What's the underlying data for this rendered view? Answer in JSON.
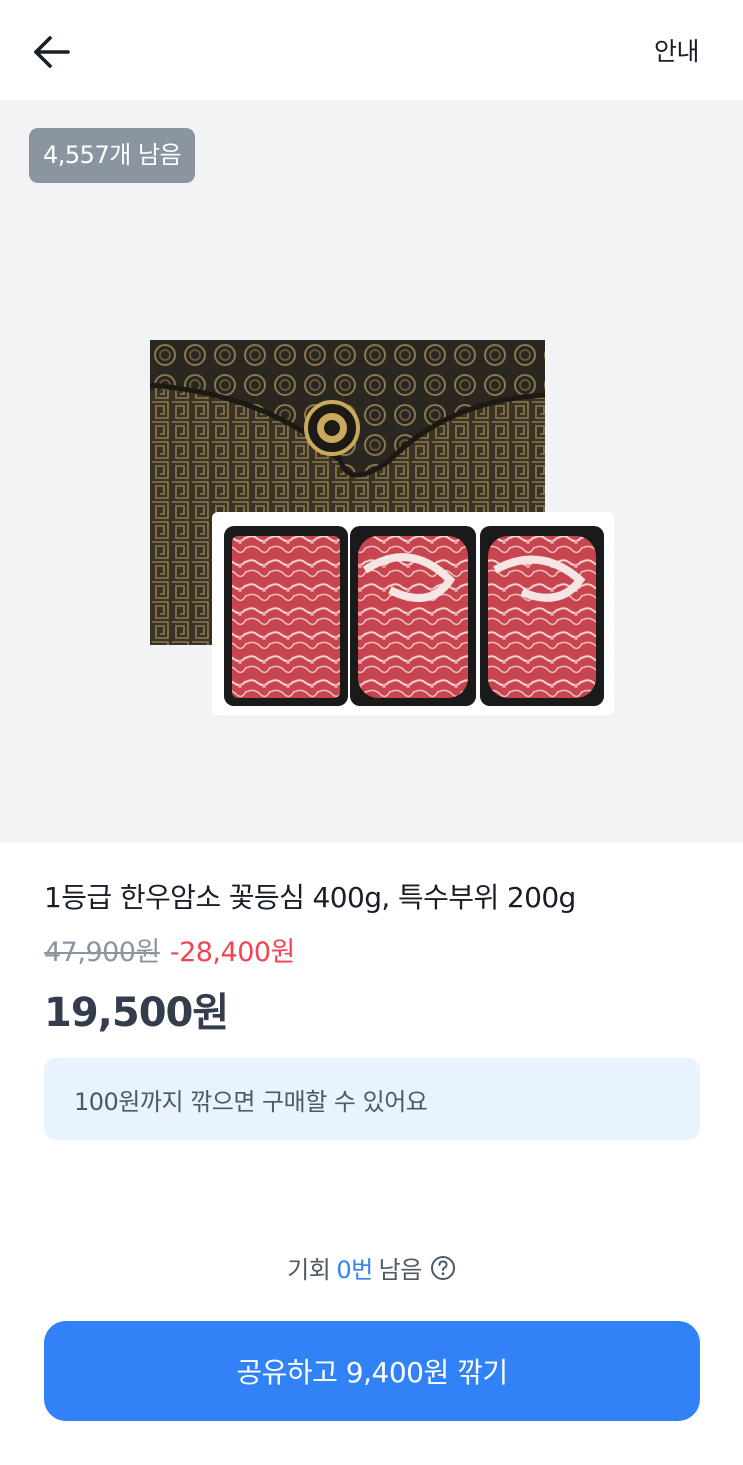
{
  "header": {
    "back_icon": "arrow-left-icon",
    "info_label": "안내"
  },
  "product": {
    "stock_badge": "4,557개 남음",
    "image_icon": "hanwoo-gift-box-image",
    "title": "1등급 한우암소 꽃등심 400g, 특수부위 200g",
    "original_price": "47,900원",
    "discount": "-28,400원",
    "current_price": "19,500원"
  },
  "notice": {
    "text": "100원까지 깎으면 구매할 수 있어요"
  },
  "chance": {
    "prefix": "기회",
    "count": "0번",
    "suffix": "남음",
    "help_icon": "question-circle-icon"
  },
  "cta": {
    "label": "공유하고 9,400원 깎기"
  },
  "colors": {
    "accent": "#3182f6",
    "discount": "#f04452",
    "badge_bg": "#8b95a1",
    "notice_bg": "#e8f3ff"
  }
}
